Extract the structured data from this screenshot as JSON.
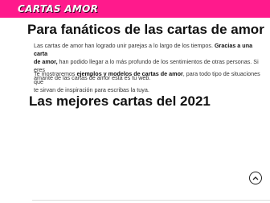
{
  "header": {
    "logo_text": "CARTAS AMOR",
    "brand_color": "#ff1a8c"
  },
  "section1": {
    "heading": "Para fanáticos de las cartas de amor",
    "para1_start": "Las cartas de amor han logrado unir parejas a lo largo de los tiempos. ",
    "para1_bold": "Gracias a una carta",
    "para1_line2_start": "de amor,",
    "para1_line2_rest": " han podido llegar a lo más profundo de los sentimientos de otras personas. Si eres",
    "para1_line3": "amante de las cartas de amor esta es tu web.",
    "para2_start": "Te mostraremos ",
    "para2_bold": "ejemplos y modelos de cartas de amor",
    "para2_rest": ", para todo tipo de situaciones que",
    "para2_line2": "te sirvan de inspiración para escribas la tuya."
  },
  "section2": {
    "heading": "Las mejores cartas del 2021"
  },
  "fab": {
    "icon": "chevron-up-icon"
  }
}
